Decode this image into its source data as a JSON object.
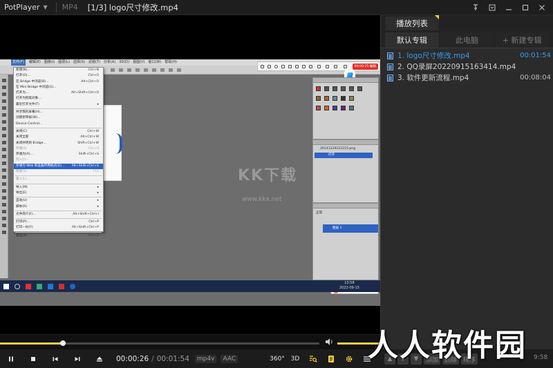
{
  "app": {
    "brand": "PotPlayer",
    "format": "MP4",
    "title": "[1/3] logo尺寸修改.mp4"
  },
  "window_buttons": {
    "pin": "pin-icon",
    "settings": "settings-icon",
    "minimize": "minimize-icon",
    "maximize": "maximize-icon",
    "close": "close-icon"
  },
  "video_frame": {
    "ps_menubar": [
      "文件(F)",
      "编辑(E)",
      "图像(I)",
      "图层(L)",
      "选择(S)",
      "滤镜(T)",
      "分析(A)",
      "3D(D)",
      "视图(V)",
      "窗口(W)",
      "帮助(H)"
    ],
    "ps_file_menu": [
      {
        "label": "新建(N)...",
        "shortcut": "Ctrl+N"
      },
      {
        "label": "打开(O)...",
        "shortcut": "Ctrl+O"
      },
      {
        "label": "在 Bridge 中浏览(B)...",
        "shortcut": "Alt+Ctrl+O"
      },
      {
        "label": "在 Mini Bridge 中浏览(G)...",
        "shortcut": ""
      },
      {
        "label": "打开为...",
        "shortcut": "Alt+Shift+Ctrl+O"
      },
      {
        "label": "打开为智能对象...",
        "shortcut": ""
      },
      {
        "label": "最近打开文件(T)",
        "shortcut": "▸"
      },
      {
        "sep": true
      },
      {
        "label": "共享我的屏幕(H)...",
        "shortcut": ""
      },
      {
        "label": "创建新审核(W)...",
        "shortcut": ""
      },
      {
        "label": "Device Central...",
        "shortcut": ""
      },
      {
        "sep": true
      },
      {
        "label": "关闭(C)",
        "shortcut": "Ctrl+W"
      },
      {
        "label": "关闭全部",
        "shortcut": "Alt+Ctrl+W"
      },
      {
        "label": "关闭并转到 Bridge...",
        "shortcut": "Shift+Ctrl+W"
      },
      {
        "label": "存储(S)",
        "shortcut": "Ctrl+S",
        "disabled": true
      },
      {
        "label": "存储为(A)...",
        "shortcut": "Shift+Ctrl+S"
      },
      {
        "label": "签入(I)...",
        "shortcut": "",
        "disabled": true
      },
      {
        "label": "存储为 Web 和设备所用格式(D)...",
        "shortcut": "Alt+Shift+Ctrl+S",
        "highlight": true
      },
      {
        "label": "恢复(V)",
        "shortcut": "F12",
        "disabled": true
      },
      {
        "sep": true
      },
      {
        "label": "置入(L)...",
        "shortcut": "",
        "disabled": true
      },
      {
        "sep": true
      },
      {
        "label": "导入(M)",
        "shortcut": "▸"
      },
      {
        "label": "导出(E)",
        "shortcut": "▸"
      },
      {
        "sep": true
      },
      {
        "label": "自动(U)",
        "shortcut": "▸"
      },
      {
        "label": "脚本(R)",
        "shortcut": "▸"
      },
      {
        "sep": true
      },
      {
        "label": "文件简介(F)...",
        "shortcut": "Alt+Shift+Ctrl+I"
      },
      {
        "sep": true
      },
      {
        "label": "打印(P)...",
        "shortcut": "Ctrl+P"
      },
      {
        "label": "打印一份(Y)",
        "shortcut": "Alt+Shift+Ctrl+P"
      },
      {
        "sep": true
      },
      {
        "label": "退出(X)",
        "shortcut": "Ctrl+Q"
      }
    ],
    "float_badge": "00:00:25 编辑",
    "history_file": "20141129222215.png",
    "history_open": "打开",
    "layers_mode": "正常",
    "layer_name": "图层 1",
    "watermark_big": "KK下载",
    "watermark_url": "www.kkx.net",
    "ime_label": "英",
    "taskbar_time": "13:58",
    "taskbar_date": "2022-09-15"
  },
  "seek": {
    "progress": 0.198,
    "volume": 1.0
  },
  "controls": {
    "play_pause": "pause-icon",
    "stop": "stop-icon",
    "prev": "prev-icon",
    "next": "next-icon",
    "eject": "eject-icon",
    "time_current": "00:00:26",
    "time_separator": "/",
    "time_total": "00:01:54",
    "codec_video": "mp4v",
    "codec_audio": "AAC",
    "vr_label": "360°",
    "threed_label": "3D"
  },
  "playlist": {
    "title": "播放列表",
    "tabs": [
      {
        "label": "默认专辑",
        "active": true
      },
      {
        "label": "此电脑",
        "active": false
      },
      {
        "label": "+ 新建专辑",
        "active": false
      }
    ],
    "items": [
      {
        "label": "1. logo尺寸修改.mp4",
        "duration": "00:01:54",
        "active": true
      },
      {
        "label": "2. QQ录屏20220915163414.mp4",
        "duration": "",
        "active": false
      },
      {
        "label": "3. 软件更新流程.mp4",
        "duration": "00:08:04",
        "active": false
      }
    ],
    "footer": {
      "add": "添加",
      "delete": "删除",
      "sort": "排序",
      "time": "9:58"
    }
  },
  "overlay_watermark": "人人软件园",
  "colors": {
    "accent_yellow": "#f2d23a",
    "active_blue": "#3d9be9",
    "panel": "#2b2b2b",
    "bar": "#1c1c1c"
  }
}
